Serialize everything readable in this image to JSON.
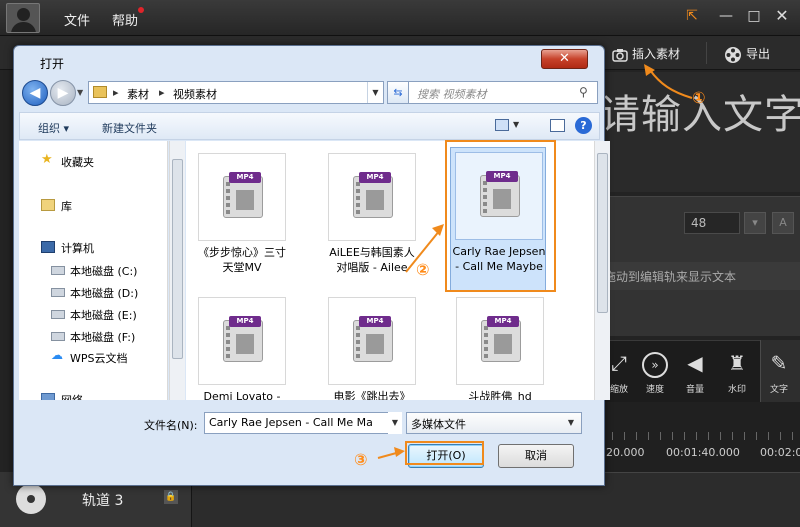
{
  "app": {
    "menu": {
      "file": "文件",
      "help": "帮助"
    },
    "window_buttons": {
      "restore": "⇱",
      "minimize": "—",
      "maximize": "□",
      "close": "✕"
    },
    "toolbar": {
      "insert_label": "插入素材",
      "export_label": "导出"
    },
    "preview_text": "请输入文字",
    "font_size": "48",
    "hint_text": "拖动到编辑轨来显示文本",
    "tools": [
      {
        "label": "缩放",
        "icon": "zoom-icon"
      },
      {
        "label": "速度",
        "icon": "speed-icon"
      },
      {
        "label": "音量",
        "icon": "volume-icon"
      },
      {
        "label": "水印",
        "icon": "watermark-icon"
      },
      {
        "label": "文字",
        "icon": "pen-icon"
      }
    ],
    "timeline": {
      "time1": "20.000",
      "time2": "00:01:40.000",
      "time3": "00:02:0"
    },
    "track": {
      "label": "轨道 3"
    }
  },
  "dialog": {
    "title": "打开",
    "close": "✕",
    "breadcrumb": [
      "素材",
      "视频素材"
    ],
    "search_placeholder": "搜索 视频素材",
    "commands": {
      "organize": "组织 ▾",
      "new_folder": "新建文件夹",
      "help": "?"
    },
    "nav_items": [
      {
        "label": "收藏夹",
        "icon": "star-icon"
      },
      {
        "label": "库",
        "icon": "library-icon"
      },
      {
        "label": "计算机",
        "icon": "computer-icon"
      },
      {
        "label": "本地磁盘 (C:)",
        "icon": "disk-icon"
      },
      {
        "label": "本地磁盘 (D:)",
        "icon": "disk-icon"
      },
      {
        "label": "本地磁盘 (E:)",
        "icon": "disk-icon"
      },
      {
        "label": "本地磁盘 (F:)",
        "icon": "disk-icon"
      },
      {
        "label": "WPS云文档",
        "icon": "cloud-icon"
      },
      {
        "label": "网络",
        "icon": "network-icon"
      }
    ],
    "files": [
      {
        "name": "《步步惊心》三寸天堂MV",
        "tag": "MP4",
        "selected": false
      },
      {
        "name": "AiLEE与韩国素人对唱版 - Ailee",
        "tag": "MP4",
        "selected": false
      },
      {
        "name": "Carly Rae Jepsen - Call Me Maybe",
        "tag": "MP4",
        "selected": true
      },
      {
        "name": "Demi Lovato -",
        "tag": "MP4",
        "selected": false
      },
      {
        "name": "电影《跳出去》",
        "tag": "MP4",
        "selected": false
      },
      {
        "name": "斗战胜佛_hd",
        "tag": "MP4",
        "selected": false
      }
    ],
    "filename_label": "文件名(N):",
    "filename_value": "Carly Rae Jepsen - Call Me Ma",
    "filetype": "多媒体文件",
    "open_button": "打开(O)",
    "cancel_button": "取消"
  },
  "annotations": {
    "step1": "①",
    "step2": "②",
    "step3": "③",
    "color": "#f08a1c"
  }
}
